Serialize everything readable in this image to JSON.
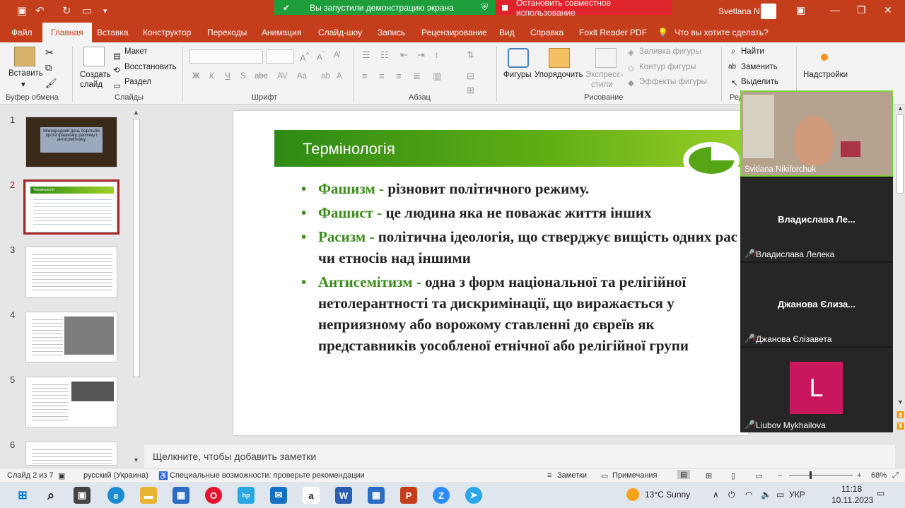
{
  "share": {
    "active_text": "Вы запустили демонстрацию экрана",
    "stop_text": "Остановить совместное использование"
  },
  "user": {
    "name": "Svetlana N"
  },
  "tabs": [
    "Файл",
    "Главная",
    "Вставка",
    "Конструктор",
    "Переходы",
    "Анимация",
    "Слайд-шоу",
    "Запись",
    "Рецензирование",
    "Вид",
    "Справка",
    "Foxit Reader PDF"
  ],
  "tell_me": "Что вы хотите сделать?",
  "ribbon": {
    "paste": "Вставить",
    "clipboard_label": "Буфер обмена",
    "new_slide": "Создать",
    "new_slide2": "слайд",
    "layout": "Макет",
    "reset": "Восстановить",
    "section": "Раздел",
    "slides_label": "Слайды",
    "font_label": "Шрифт",
    "paragraph_label": "Абзац",
    "shapes": "Фигуры",
    "arrange": "Упорядочить",
    "styles1": "Экспресс-",
    "styles2": "стили",
    "fill": "Заливка фигуры",
    "outline": "Контур фигуры",
    "effects": "Эффекты фигуры",
    "drawing_label": "Рисование",
    "find": "Найти",
    "replace": "Заменить",
    "select": "Выделить",
    "editing_label": "Ред",
    "addins": "Надстройки"
  },
  "thumbnails": [
    "1",
    "2",
    "3",
    "4",
    "5",
    "6"
  ],
  "thumb1_text": "Міжнародний день боротьби проти фашизму, расизму і антисемітизму",
  "thumb2_title": "Термінологія",
  "slide": {
    "title": "Термінологія",
    "bullets": [
      {
        "term": "Фашизм -",
        "text": " різновит політичного режиму."
      },
      {
        "term": "Фашист -",
        "text": " це людина яка не поважає життя інших"
      },
      {
        "term": "Расизм -",
        "text": " політична ідеологія, що стверджує вищість одних рас чи етносів над іншими"
      },
      {
        "term": "Антисемітизм -",
        "text": " одна з форм національної та релігійної нетолерантності та дискримінації, що виражається у неприязному або ворожому ставленні до євреїв як представників уособленої етнічної або релігійної групи"
      }
    ]
  },
  "video": {
    "p1": "Svitlana Nikiforchuk",
    "p2_big": "Владислава  Ле...",
    "p2_small": "Владислава Лелека",
    "p3_big": "Джанова Єлиза...",
    "p3_small": "Джанова Єлізавета",
    "p4_initial": "L",
    "p4_small": "Liubov Mykhailova"
  },
  "notes_placeholder": "Щелкните, чтобы добавить заметки",
  "status": {
    "slide": "Слайд 2 из 7",
    "lang": "русский (Украина)",
    "a11y": "Специальные возможности: проверьте рекомендации",
    "notes": "Заметки",
    "comments": "Примечания",
    "zoom": "68%"
  },
  "taskbar": {
    "weather": "13°C  Sunny",
    "lang": "УКР",
    "time": "11:18",
    "date": "10.11.2023"
  },
  "colors": {
    "accent": "#c43e1c",
    "green": "#3b8a1c",
    "share_green": "#1e9e3a",
    "share_red": "#e0242b"
  }
}
